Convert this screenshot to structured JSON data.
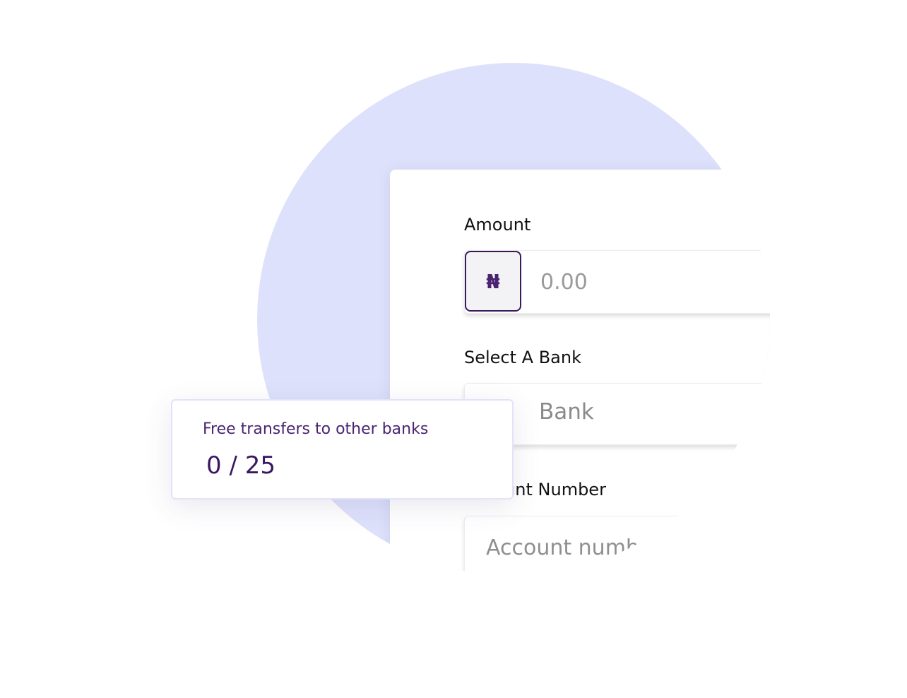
{
  "form": {
    "amount_label": "Amount",
    "currency_symbol": "₦",
    "amount_placeholder": "0.00",
    "bank_label": "Select A Bank",
    "bank_value": "Bank",
    "account_label": "Account Number",
    "account_placeholder": "Account number"
  },
  "info_card": {
    "title": "Free transfers to other banks",
    "count": "0 / 25"
  },
  "colors": {
    "background_circle": "#dee1fb",
    "accent_purple": "#4a2470",
    "info_border": "#e3e2fb"
  },
  "icons": {
    "currency": "naira-icon"
  }
}
